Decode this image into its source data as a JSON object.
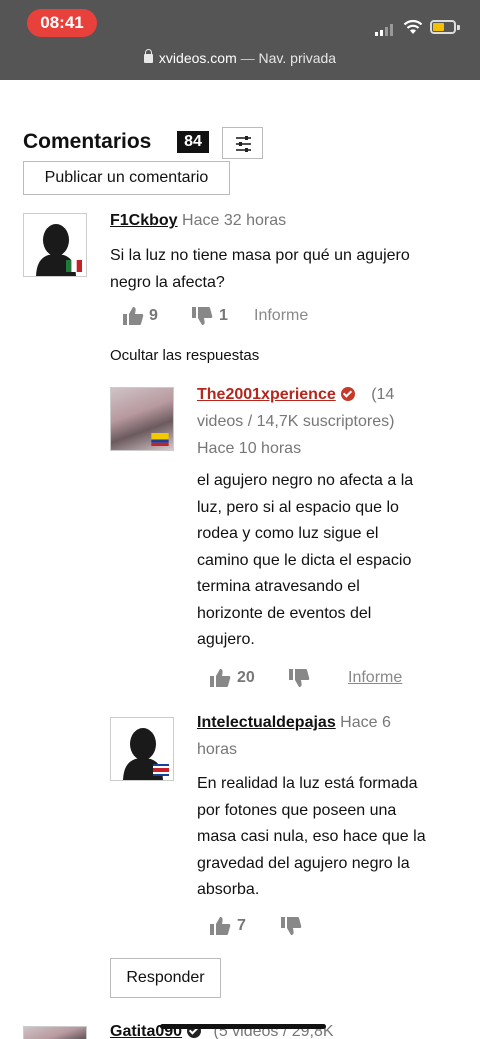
{
  "status": {
    "time": "08:41"
  },
  "browser": {
    "domain": "xvideos.com",
    "separator": " — ",
    "mode": "Nav. privada"
  },
  "comments_section": {
    "title": "Comentarios",
    "count": "84",
    "publish_label": "Publicar un comentario",
    "hide_replies_label": "Ocultar las respuestas",
    "reply_label": "Responder"
  },
  "comments": [
    {
      "user": "F1Ckboy",
      "time": "Hace 32 horas",
      "text_lines": [
        "Si la luz no tiene masa por qué un agujero",
        "negro la afecta?"
      ],
      "likes": "9",
      "dislikes": "1",
      "report": "Informe",
      "flag": "mexico"
    }
  ],
  "replies": [
    {
      "user": "The2001xperience",
      "stats_lines": [
        "(14",
        "videos / 14,7K suscriptores)"
      ],
      "time": "Hace 10 horas",
      "text_lines": [
        "el agujero negro no afecta a la",
        "luz, pero si al espacio que lo",
        "rodea y como luz sigue el",
        "camino que le dicta el espacio",
        "termina atravesando el",
        "horizonte de eventos del",
        "agujero."
      ],
      "likes": "20",
      "report": "Informe",
      "flag": "colombia"
    },
    {
      "user": "Intelectualdepajas",
      "time_lines": [
        "Hace 6",
        "horas"
      ],
      "text_lines": [
        "En realidad la luz está formada",
        "por fotones que poseen una",
        "masa casi nula, eso hace que la",
        "gravedad del agujero negro la",
        "absorba."
      ],
      "likes": "7",
      "flag": "costa-rica"
    },
    {
      "user": "Gatita090",
      "stats": "(5 videos / 29,8K"
    }
  ],
  "colors": {
    "accent_red": "#b5261d",
    "status_pill": "#e8403a",
    "battery": "#f2c200"
  },
  "icons": [
    "lock-icon",
    "filter-sliders-icon",
    "thumbs-up-icon",
    "thumbs-down-icon",
    "verified-badge-icon",
    "wifi-icon",
    "signal-icon",
    "battery-icon",
    "user-silhouette-icon"
  ]
}
